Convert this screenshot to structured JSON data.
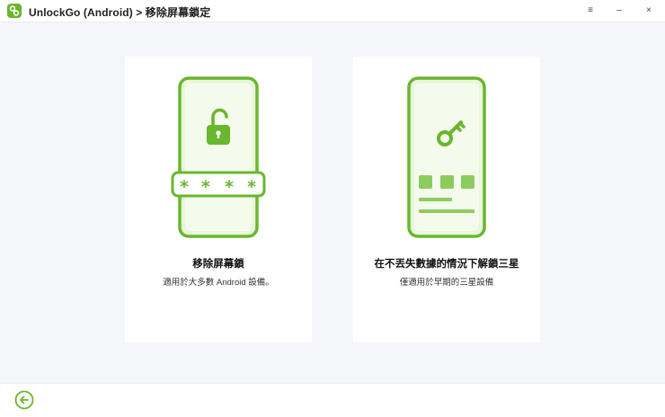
{
  "window": {
    "title": "UnlockGo (Android) > 移除屏幕鎖定",
    "controls": {
      "menu": "≡",
      "minimize": "–",
      "close": "×"
    }
  },
  "cards": [
    {
      "title": "移除屏幕鎖",
      "description": "適用於大多數 Android 設備。",
      "icon": "unlock-phone-icon"
    },
    {
      "title": "在不丟失數據的情況下解鎖三星",
      "description": "僅適用於早期的三星設備",
      "icon": "key-phone-icon"
    }
  ],
  "footer": {
    "back_icon": "back-arrow-icon"
  },
  "colors": {
    "accent": "#68b72e",
    "accent_light": "#e8f5d6",
    "background": "#f5f6fa"
  }
}
